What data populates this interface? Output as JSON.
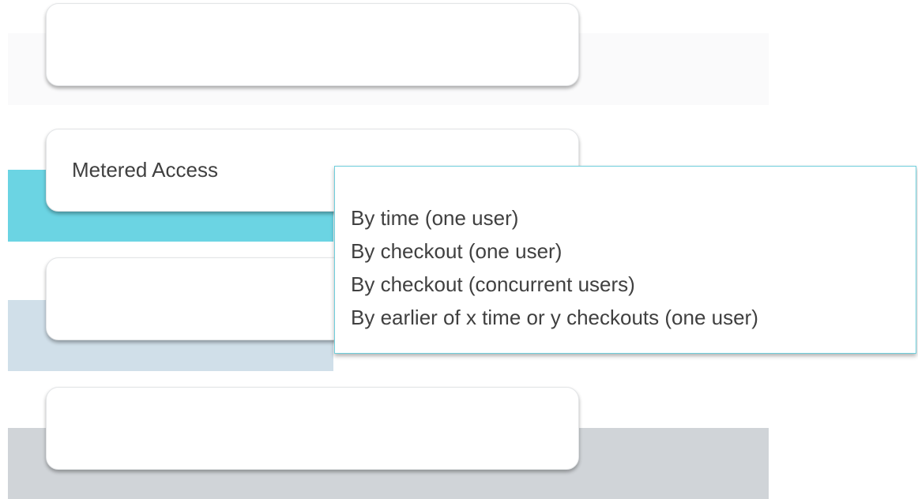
{
  "cards": [
    {
      "label": ""
    },
    {
      "label": "Metered Access"
    },
    {
      "label": ""
    },
    {
      "label": ""
    }
  ],
  "options": [
    "By time (one user)",
    "By checkout (one user)",
    "By checkout (concurrent users)",
    "By earlier of x time or y checkouts (one user)"
  ],
  "colors": {
    "band_1": "#fafafb",
    "band_2": "#6bd4e3",
    "band_3": "#d0dfe9",
    "band_4": "#d0d4d8",
    "options_border": "#6fcfdc",
    "text": "#404040"
  }
}
